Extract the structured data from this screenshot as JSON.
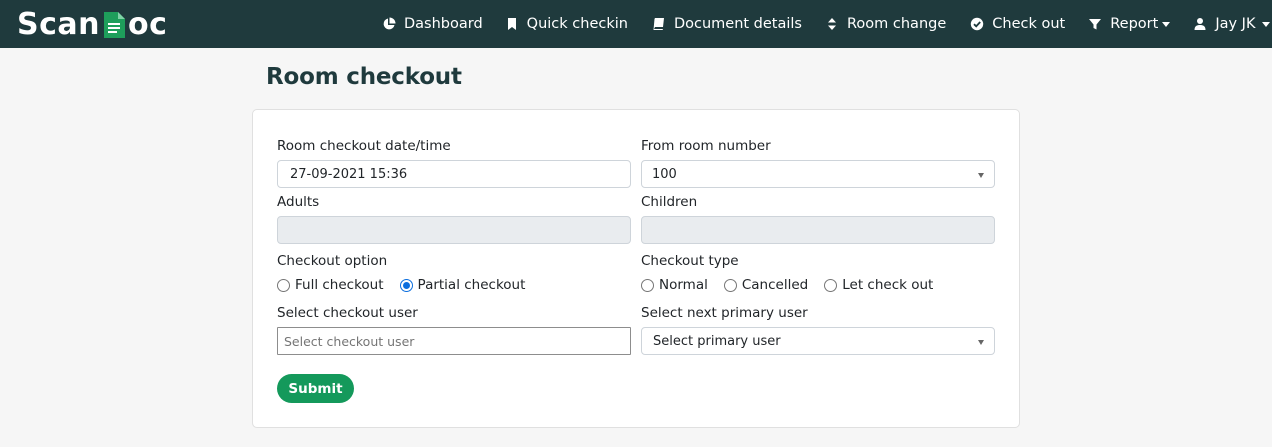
{
  "app": {
    "brand_left": "Scan",
    "brand_right": "oc"
  },
  "nav": {
    "items": [
      {
        "label": "Dashboard",
        "icon": "pie-chart-icon"
      },
      {
        "label": "Quick checkin",
        "icon": "bookmark-icon"
      },
      {
        "label": "Document details",
        "icon": "book-icon"
      },
      {
        "label": "Room change",
        "icon": "sort-icon"
      },
      {
        "label": "Check out",
        "icon": "check-circle-icon"
      },
      {
        "label": "Report",
        "icon": "filter-icon"
      },
      {
        "label": "Jay JK",
        "icon": "user-icon"
      }
    ]
  },
  "page": {
    "title": "Room checkout"
  },
  "form": {
    "checkout_datetime": {
      "label": "Room checkout date/time",
      "value": "27-09-2021 15:36"
    },
    "from_room": {
      "label": "From room number",
      "value": "100"
    },
    "adults": {
      "label": "Adults",
      "value": ""
    },
    "children": {
      "label": "Children",
      "value": ""
    },
    "checkout_option": {
      "label": "Checkout option",
      "options": [
        "Full checkout",
        "Partial checkout"
      ],
      "selected": "Partial checkout"
    },
    "checkout_type": {
      "label": "Checkout type",
      "options": [
        "Normal",
        "Cancelled",
        "Let check out"
      ],
      "selected": ""
    },
    "checkout_user": {
      "label": "Select checkout user",
      "placeholder": "Select checkout user"
    },
    "primary_user": {
      "label": "Select next primary user",
      "value": "Select primary user"
    },
    "submit_label": "Submit"
  },
  "colors": {
    "navbar": "#1f3a3d",
    "accent": "#14995b",
    "brand_icon": "#1e9e5b"
  }
}
